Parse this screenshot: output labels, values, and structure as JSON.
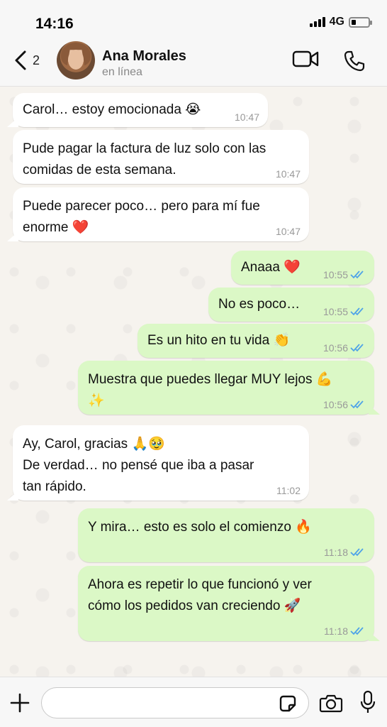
{
  "status_bar": {
    "time": "14:16",
    "network": "4G"
  },
  "header": {
    "back_count": "2",
    "contact_name": "Ana Morales",
    "contact_status": "en línea"
  },
  "messages": [
    {
      "direction": "in",
      "lines": [
        "Carol… estoy emocionada 😭"
      ],
      "time": "10:47"
    },
    {
      "direction": "in",
      "lines": [
        "Pude pagar la factura de luz solo con las",
        "comidas de esta semana."
      ],
      "time": "10:47"
    },
    {
      "direction": "in",
      "lines": [
        "Puede parecer poco… pero para mí fue",
        "enorme ❤️"
      ],
      "time": "10:47"
    },
    {
      "direction": "out",
      "lines": [
        "Anaaa ❤️"
      ],
      "time": "10:55",
      "read": true
    },
    {
      "direction": "out",
      "lines": [
        "No es poco…"
      ],
      "time": "10:55",
      "read": true
    },
    {
      "direction": "out",
      "lines": [
        "Es un hito en tu vida 👏"
      ],
      "time": "10:56",
      "read": true
    },
    {
      "direction": "out",
      "lines": [
        "Muestra que puedes llegar MUY lejos 💪",
        "✨"
      ],
      "time": "10:56",
      "read": true
    },
    {
      "direction": "in",
      "lines": [
        "Ay, Carol, gracias 🙏🥹",
        "De verdad… no pensé que iba a pasar",
        "tan rápido."
      ],
      "time": "11:02"
    },
    {
      "direction": "out",
      "lines": [
        "Y mira… esto es solo el comienzo 🔥"
      ],
      "time": "11:18",
      "read": true
    },
    {
      "direction": "out",
      "lines": [
        "Ahora es repetir lo que funcionó y ver",
        "cómo los pedidos van creciendo 🚀"
      ],
      "time": "11:18",
      "read": true
    }
  ],
  "composer": {
    "placeholder": ""
  },
  "colors": {
    "outgoing_bubble": "#dbf8c6",
    "incoming_bubble": "#ffffff",
    "read_ticks": "#4fa3e8",
    "chat_background": "#f6f3ee"
  }
}
